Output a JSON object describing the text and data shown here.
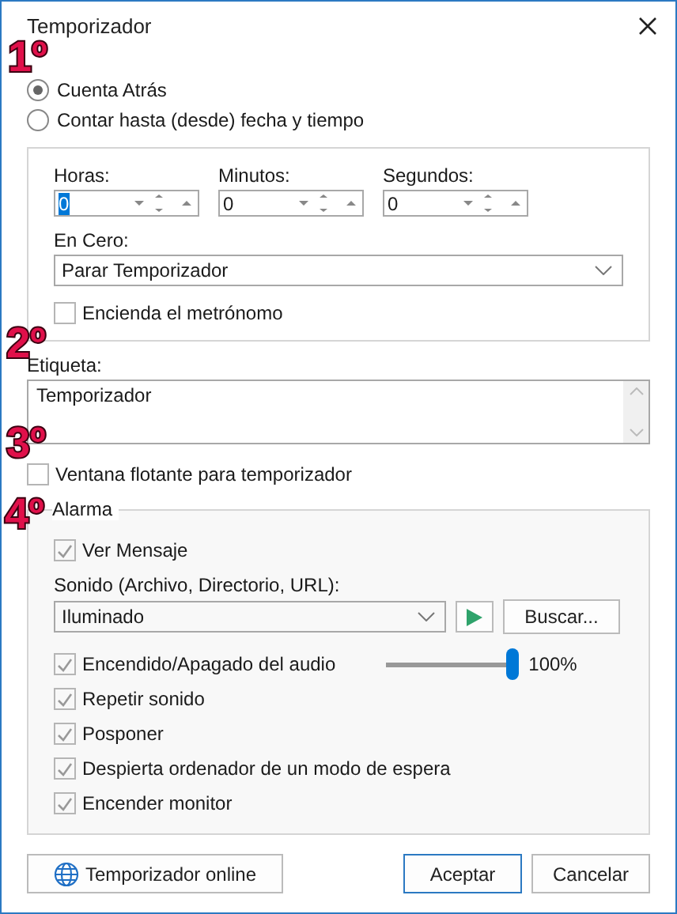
{
  "window": {
    "title": "Temporizador"
  },
  "mode_options": [
    {
      "label": "Cuenta Atrás",
      "selected": true
    },
    {
      "label": "Contar hasta (desde) fecha y tiempo",
      "selected": false
    }
  ],
  "time_fields": [
    {
      "label": "Horas:",
      "value": "0",
      "highlighted": true
    },
    {
      "label": "Minutos:",
      "value": "0",
      "highlighted": false
    },
    {
      "label": "Segundos:",
      "value": "0",
      "highlighted": false
    }
  ],
  "at_zero": {
    "label": "En Cero:",
    "value": "Parar Temporizador"
  },
  "metronome": {
    "label": "Encienda el metrónomo",
    "checked": false
  },
  "tag": {
    "label": "Etiqueta:",
    "value": "Temporizador"
  },
  "floating_window": {
    "label": "Ventana flotante para temporizador",
    "checked": false
  },
  "alarm": {
    "title": "Alarma",
    "show_message": {
      "label": "Ver Mensaje",
      "checked": true
    },
    "sound": {
      "label": "Sonido (Archivo, Directorio, URL):",
      "value": "Iluminado",
      "browse": "Buscar..."
    },
    "options": [
      {
        "kind": "volume",
        "label": "Encendido/Apagado del audio",
        "checked": true,
        "level": 1,
        "reading": "100%"
      },
      {
        "kind": "check",
        "label": "Repetir sonido",
        "checked": true
      },
      {
        "kind": "check",
        "label": "Posponer",
        "checked": true
      },
      {
        "kind": "check",
        "label": "Despierta ordenador de un modo de espera",
        "checked": true
      },
      {
        "kind": "check",
        "label": "Encender monitor",
        "checked": true
      }
    ]
  },
  "buttons": {
    "online": "Temporizador online",
    "ok": "Aceptar",
    "cancel": "Cancelar"
  },
  "annotations": [
    "1º",
    "2º",
    "3º",
    "4º"
  ]
}
